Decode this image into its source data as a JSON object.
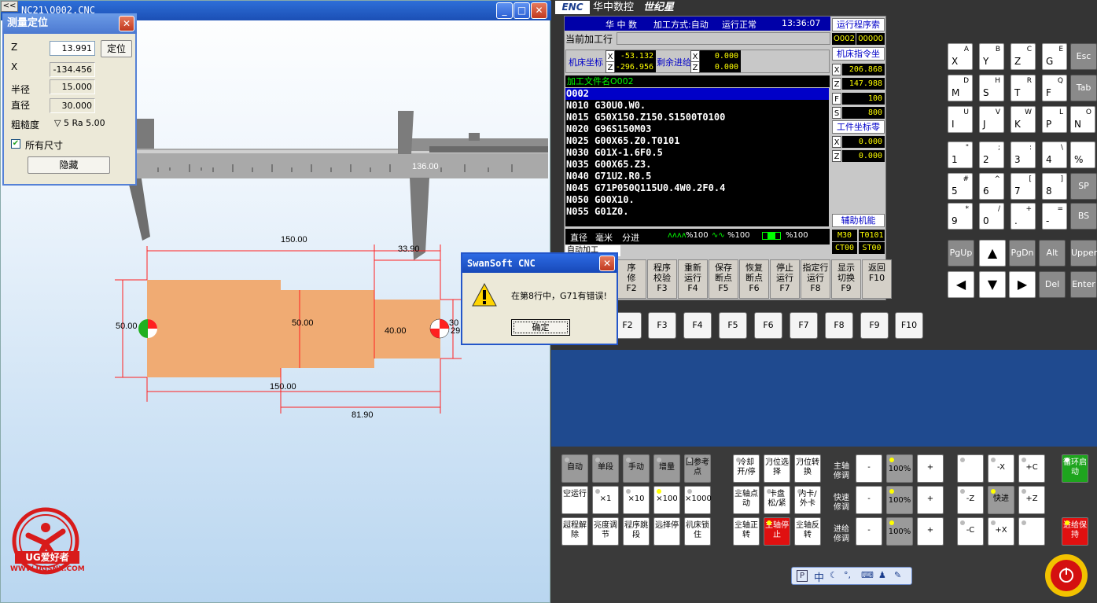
{
  "sim_window": {
    "title": "NC21\\O002.CNC",
    "back_label": "<<",
    "ruler_reading": "136.00",
    "dims": {
      "top_len": "150.00",
      "right_step": "33.90",
      "d_left": "50.00",
      "d_mid": "50.00",
      "d_right": "40.00",
      "right_a": "30",
      "right_b": "29",
      "bottom_len": "150.00",
      "bottom_sub": "81.90"
    }
  },
  "measure": {
    "title": "测量定位",
    "z_label": "Z",
    "z_value": "13.991",
    "locate_btn": "定位",
    "x_label": "X",
    "x_value": "-134.456",
    "radius_label": "半径",
    "radius_value": "15.000",
    "diameter_label": "直径",
    "diameter_value": "30.000",
    "roughness_label": "粗糙度",
    "roughness_value": "▽ 5  Ra 5.00",
    "all_dims_label": "所有尺寸",
    "hide_btn": "隐藏"
  },
  "swan": {
    "title": "SwanSoft CNC",
    "message": "在第8行中，G71有错误!",
    "ok": "确定"
  },
  "cnc": {
    "brand": "华中数控",
    "brand2": "世纪星",
    "mode_tab": "华 中 数",
    "mode_text": "加工方式:自动",
    "status_text": "运行正常",
    "time": "13:36:07",
    "current_line_label": "当前加工行",
    "machine_coord_label": "机床坐标",
    "remaining_label": "剩余进给",
    "mx": "-53.132",
    "mz": "-296.956",
    "rx": "0.000",
    "rz": "0.000",
    "file_label": "加工文件名O002",
    "code": [
      "O002",
      "N010 G30U0.W0.",
      "N015 G50X150.Z150.S1500T0100",
      "N020 G96S150M03",
      "N025 G00X65.Z0.T0101",
      "N030 G01X-1.6F0.5",
      "N035 G00X65.Z3.",
      "N040 G71U2.R0.5",
      "N045 G71P050Q115U0.4W0.2F0.4",
      "N050 G00X10.",
      "N055 G01Z0."
    ],
    "prog_index_label": "运行程序索",
    "prog_name": "O002",
    "prog_num": "00000",
    "cmd_coord_label": "机床指令坐",
    "cx": "206.868",
    "cz": "147.988",
    "cf": "100",
    "cs": "800",
    "work_zero_label": "工件坐标零",
    "wx": "0.000",
    "wz": "0.000",
    "aux_label": "辅助机能",
    "m_code": "M30",
    "t_code": "T0101",
    "ct_code": "CT00",
    "st_code": "ST00",
    "status_bar": [
      "直径",
      "毫米",
      "分进",
      "%100",
      "%100",
      "%100"
    ],
    "auto_tab": "自动加工",
    "fkeys": [
      {
        "l1": "序",
        "l2": "修",
        "k": "F2"
      },
      {
        "l1": "程序",
        "l2": "校验",
        "k": "F3"
      },
      {
        "l1": "重新",
        "l2": "运行",
        "k": "F4"
      },
      {
        "l1": "保存",
        "l2": "断点",
        "k": "F5"
      },
      {
        "l1": "恢复",
        "l2": "断点",
        "k": "F6"
      },
      {
        "l1": "停止",
        "l2": "运行",
        "k": "F7"
      },
      {
        "l1": "指定行",
        "l2": "运行",
        "k": "F8"
      },
      {
        "l1": "显示",
        "l2": "切换",
        "k": "F9"
      },
      {
        "l1": "返回",
        "l2": "",
        "k": "F10"
      }
    ],
    "fbtns": [
      "F2",
      "F3",
      "F4",
      "F5",
      "F6",
      "F7",
      "F8",
      "F9",
      "F10"
    ]
  },
  "keyboard": {
    "rows": [
      [
        {
          "m": "X",
          "s": "A"
        },
        {
          "m": "Y",
          "s": "B"
        },
        {
          "m": "Z",
          "s": "C"
        },
        {
          "m": "G",
          "s": "E"
        }
      ],
      [
        {
          "m": "M",
          "s": "D"
        },
        {
          "m": "S",
          "s": "H"
        },
        {
          "m": "T",
          "s": "R"
        },
        {
          "m": "F",
          "s": "Q"
        }
      ],
      [
        {
          "m": "I",
          "s": "U"
        },
        {
          "m": "J",
          "s": "V"
        },
        {
          "m": "K",
          "s": "W"
        },
        {
          "m": "P",
          "s": "L"
        },
        {
          "m": "N",
          "s": "O"
        }
      ],
      [
        {
          "m": "1",
          "s": "\""
        },
        {
          "m": "2",
          "s": ";"
        },
        {
          "m": "3",
          "s": ":"
        },
        {
          "m": "4",
          "s": "\\"
        },
        {
          "m": "%",
          "s": ""
        }
      ],
      [
        {
          "m": "5",
          "s": "#"
        },
        {
          "m": "6",
          "s": "^"
        },
        {
          "m": "7",
          "s": "["
        },
        {
          "m": "8",
          "s": "]"
        }
      ],
      [
        {
          "m": "9",
          "s": "*"
        },
        {
          "m": "0",
          "s": "/"
        },
        {
          "m": ".",
          "s": "+"
        },
        {
          "m": "-",
          "s": "="
        }
      ]
    ],
    "gray": [
      "Esc",
      "Tab",
      "SP",
      "BS"
    ],
    "nav": [
      "PgUp",
      "PgDn",
      "Alt",
      "Upper",
      "Del",
      "Enter"
    ]
  },
  "operator": {
    "row1": [
      "自动",
      "单段",
      "手动",
      "增量",
      "回参考点"
    ],
    "row2": [
      "空运行",
      "×1",
      "×10",
      "×100",
      "×1000"
    ],
    "row3": [
      "超程解除",
      "亮度调节",
      "程序跳段",
      "选择停",
      "机床锁住"
    ],
    "mid1": [
      "冷却开/停",
      "刀位选择",
      "刀位转换"
    ],
    "mid2": [
      "主轴点动",
      "卡盘松/紧",
      "内卡/外卡"
    ],
    "mid3": [
      "主轴正转",
      "主轴停止",
      "主轴反转"
    ],
    "ovr_labels": [
      "主轴修调",
      "快速修调",
      "进给修调"
    ],
    "ovr_value": "100%",
    "minus": "-",
    "plus": "+",
    "jog": [
      "-X",
      "+C",
      "-Z",
      "快进",
      "+Z",
      "-C",
      "+X"
    ],
    "cycle_start": "循环启动",
    "feed_hold": "进给保持"
  },
  "logo": {
    "text": "UG爱好者",
    "url": "WWW.UGSNX.COM"
  },
  "taskbar": {
    "lang": "中"
  }
}
